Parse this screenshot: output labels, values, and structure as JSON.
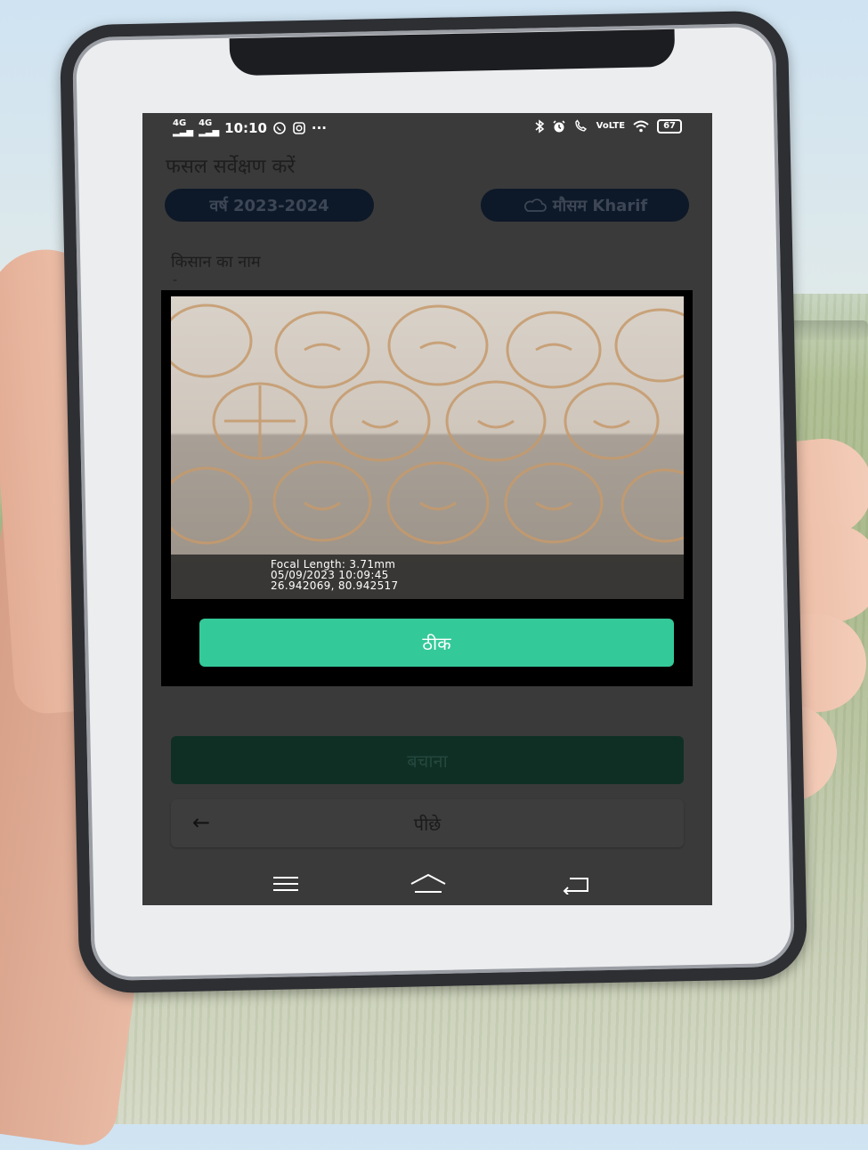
{
  "status_bar": {
    "network_left": "4G",
    "network_right": "4G",
    "time": "10:10",
    "more": "···",
    "volte": "VoLTE",
    "battery": "67",
    "icons_left": [
      "signal-icon",
      "signal-icon",
      "whatsapp-icon",
      "instagram-icon"
    ],
    "icons_right": [
      "bluetooth-icon",
      "alarm-icon",
      "wifi-call-icon",
      "volte-icon",
      "wifi-icon",
      "battery-icon"
    ]
  },
  "page": {
    "title": "फसल सर्वेक्षण करें",
    "year_chip": "वर्ष 2023-2024",
    "season_chip": "मौसम Kharif",
    "farmer_label": "किसान का नाम",
    "farmer_value": "-"
  },
  "dialog": {
    "photo_overlay": {
      "line1": "Focal Length: 3.71mm",
      "line2": "05/09/2023 10:09:45",
      "line3": "26.942069, 80.942517"
    },
    "ok_button": "ठीक"
  },
  "actions": {
    "save_button": "बचाना",
    "back_button": "पीछे"
  },
  "navbar": {
    "icons": [
      "menu-icon",
      "home-icon",
      "back-icon"
    ]
  }
}
